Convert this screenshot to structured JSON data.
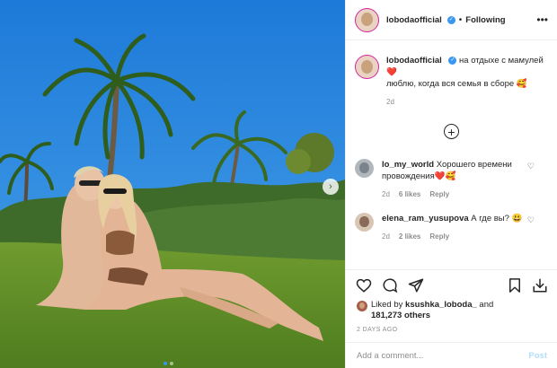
{
  "post": {
    "image_alt": "Two women sitting on grass under palm trees",
    "carousel": {
      "count": 2,
      "active_index": 0
    },
    "next_icon": "chevron-right-icon"
  },
  "header": {
    "username": "lobodaofficial",
    "verified_icon": "verified-badge-icon",
    "separator": "•",
    "follow_status": "Following",
    "more_icon": "more-horizontal-icon"
  },
  "caption": {
    "username": "lobodaofficial",
    "line1": "на отдыхе с мамулей ❤️",
    "line2": "люблю, когда вся семья в сборе 🥰",
    "time": "2d"
  },
  "load_more_icon": "plus-circle-icon",
  "comments": [
    {
      "username": "lo_my_world",
      "text": "Хорошего времени провождения❤️🥰",
      "time": "2d",
      "likes": "6 likes",
      "reply": "Reply"
    },
    {
      "username": "elena_ram_yusupova",
      "text": "А где вы? 😃",
      "time": "2d",
      "likes": "2 likes",
      "reply": "Reply"
    }
  ],
  "actions": {
    "like_icon": "heart-icon",
    "comment_icon": "comment-icon",
    "share_icon": "share-icon",
    "save_icon": "bookmark-icon",
    "download_icon": "download-icon"
  },
  "likes": {
    "prefix": "Liked by",
    "user": "ksushka_loboda_",
    "and": "and",
    "others": "181,273 others"
  },
  "posted": "2 DAYS AGO",
  "comment_input": {
    "placeholder": "Add a comment...",
    "post_label": "Post"
  },
  "colors": {
    "accent": "#3897f0",
    "post_disabled": "#b2dffc",
    "muted": "#8e8e8e"
  }
}
